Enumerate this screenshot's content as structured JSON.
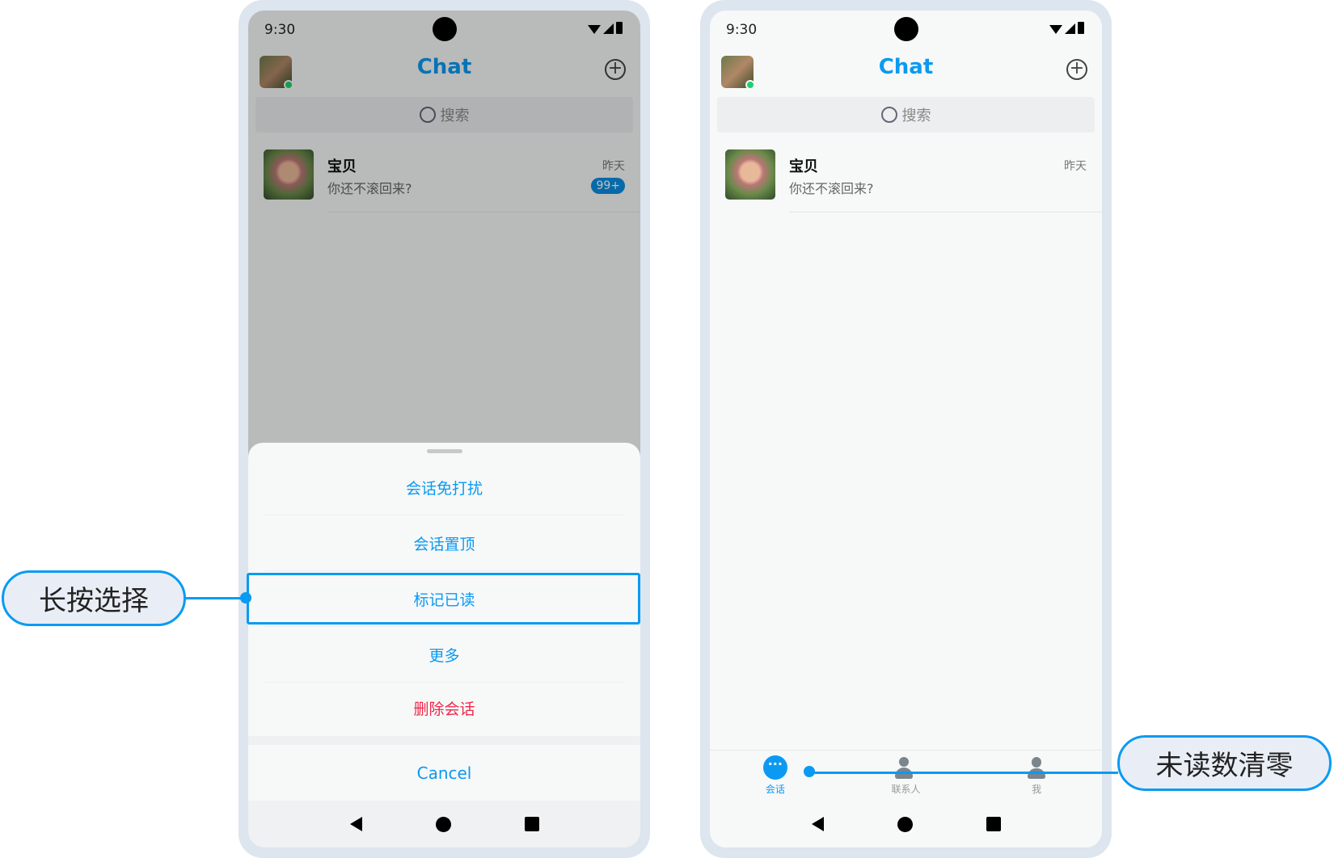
{
  "left_phone": {
    "status": {
      "time": "9:30"
    },
    "header": {
      "title": "Chat"
    },
    "search": {
      "placeholder": "搜索"
    },
    "conversation": {
      "name": "宝贝",
      "message": "你还不滚回来?",
      "time": "昨天",
      "unread": "99+"
    },
    "action_sheet": {
      "items": [
        {
          "label": "会话免打扰"
        },
        {
          "label": "会话置顶"
        },
        {
          "label": "标记已读"
        },
        {
          "label": "更多"
        },
        {
          "label": "删除会话"
        }
      ],
      "cancel": "Cancel"
    }
  },
  "right_phone": {
    "status": {
      "time": "9:30"
    },
    "header": {
      "title": "Chat"
    },
    "search": {
      "placeholder": "搜索"
    },
    "conversation": {
      "name": "宝贝",
      "message": "你还不滚回来?",
      "time": "昨天"
    },
    "tabs": [
      {
        "label": "会话"
      },
      {
        "label": "联系人"
      },
      {
        "label": "我"
      }
    ]
  },
  "annotations": {
    "left": "长按选择",
    "right": "未读数清零"
  },
  "colors": {
    "accent": "#0a9af2",
    "danger": "#f0284a",
    "frame": "#dde5ee"
  }
}
